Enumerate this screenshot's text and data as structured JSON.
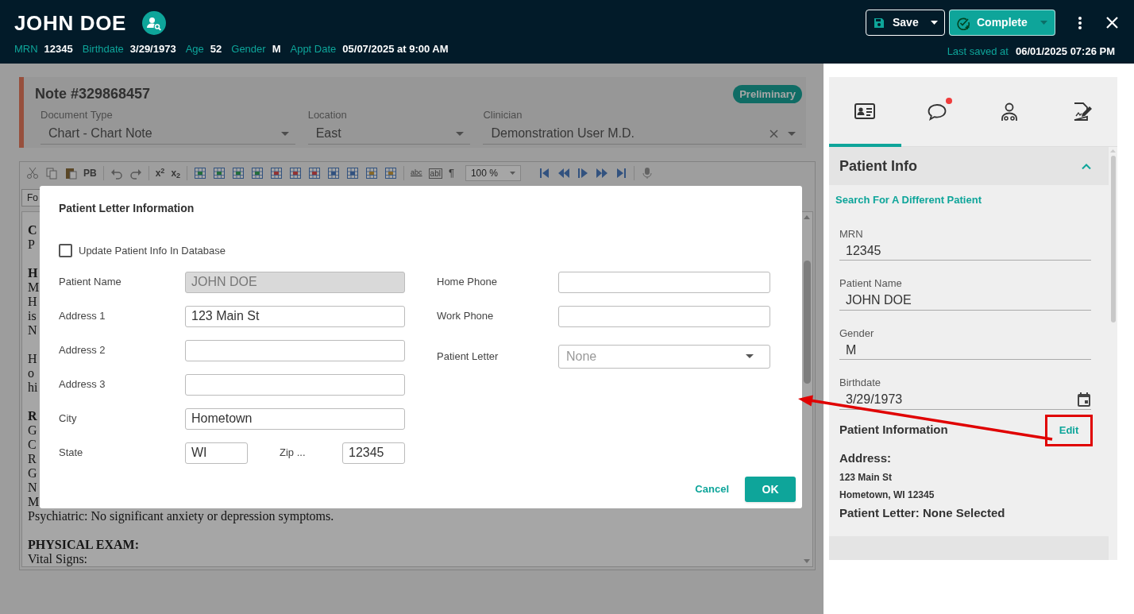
{
  "header": {
    "patient_name": "JOHN DOE",
    "meta": [
      {
        "label": "MRN",
        "value": "12345"
      },
      {
        "label": "Birthdate",
        "value": "3/29/1973"
      },
      {
        "label": "Age",
        "value": "52"
      },
      {
        "label": "Gender",
        "value": "M"
      },
      {
        "label": "Appt Date",
        "value": "05/07/2025 at 9:00 AM"
      }
    ],
    "save_button": "Save",
    "complete_button": "Complete",
    "last_saved_label": "Last saved at",
    "last_saved_value": "06/01/2025 07:26 PM"
  },
  "note": {
    "title": "Note #329868457",
    "status": "Preliminary",
    "fields": [
      {
        "label": "Document Type",
        "value": "Chart - Chart Note",
        "clearable": false
      },
      {
        "label": "Location",
        "value": "East",
        "clearable": false
      },
      {
        "label": "Clinician",
        "value": "Demonstration User M.D.",
        "clearable": true
      }
    ]
  },
  "toolbar": {
    "paste_special": "PB",
    "superscript": "x$^{2}$",
    "subscript": "x$_{2}$",
    "spellcheck": "abc",
    "field": "abl",
    "pilcrow": "¶",
    "zoom": "100 %"
  },
  "font_select": "Fo",
  "editor": {
    "paragraphs": [
      {
        "lines": [
          {
            "text": "C",
            "bold": true
          },
          {
            "text": "P",
            "bold": false
          }
        ]
      },
      {
        "lines": [
          {
            "text": "H",
            "bold": true
          },
          {
            "text": "M",
            "bold": false
          },
          {
            "text": "H",
            "bold": false
          },
          {
            "text": "is",
            "bold": false
          },
          {
            "text": "N",
            "bold": false
          }
        ]
      },
      {
        "lines": [
          {
            "text": "H",
            "bold": false
          },
          {
            "text": "o",
            "bold": false
          },
          {
            "text": "hi",
            "bold": false
          }
        ]
      },
      {
        "lines": [
          {
            "text": "R",
            "bold": true
          },
          {
            "text": "G",
            "bold": false
          },
          {
            "text": "C",
            "bold": false
          },
          {
            "text": "R",
            "bold": false
          },
          {
            "text": "G",
            "bold": false
          },
          {
            "text": "N",
            "bold": false
          },
          {
            "text": "M",
            "bold": false
          },
          {
            "text": "Psychiatric: No significant anxiety or depression symptoms.",
            "bold": false
          }
        ]
      },
      {
        "lines": [
          {
            "text": "PHYSICAL EXAM:",
            "bold": true
          },
          {
            "text": "Vital Signs:",
            "bold": false
          }
        ]
      }
    ]
  },
  "dialog": {
    "title": "Patient Letter Information",
    "update_checkbox": {
      "label": "Update Patient Info In Database",
      "checked": false
    },
    "left_fields": [
      {
        "label": "Patient Name",
        "value": "JOHN DOE",
        "disabled": true
      },
      {
        "label": "Address 1",
        "value": "123 Main St",
        "disabled": false
      },
      {
        "label": "Address 2",
        "disabled": false
      },
      {
        "label": "Address 3",
        "disabled": false
      },
      {
        "label": "City",
        "value": "Hometown",
        "disabled": false
      }
    ],
    "state": {
      "label": "State",
      "value": "WI"
    },
    "zip": {
      "label": "Zip ...",
      "value": "12345"
    },
    "right_fields": [
      {
        "label": "Home Phone",
        "kind": "text"
      },
      {
        "label": "Work Phone",
        "kind": "text"
      },
      {
        "label": "Patient Letter",
        "kind": "select",
        "placeholder": "None"
      }
    ],
    "cancel_button": "Cancel",
    "ok_button": "OK"
  },
  "sidebar": {
    "tabs": [
      {
        "selected": true,
        "notification": false
      },
      {
        "selected": false,
        "notification": true
      },
      {
        "selected": false,
        "notification": false
      },
      {
        "selected": false,
        "notification": false
      }
    ],
    "section": {
      "title": "Patient Info",
      "expanded": true,
      "search_link": "Search For A Different Patient",
      "fields": [
        {
          "label": "MRN",
          "value": "12345",
          "kind": "text"
        },
        {
          "label": "Patient Name",
          "value": "JOHN DOE",
          "kind": "text"
        },
        {
          "label": "Gender",
          "value": "M",
          "kind": "text"
        },
        {
          "label": "Birthdate",
          "value": "3/29/1973",
          "kind": "date"
        }
      ],
      "info_title": "Patient Information",
      "edit_link": "Edit",
      "address_label": "Address:",
      "address_lines": [
        "123 Main St",
        "Hometown, WI 12345"
      ],
      "patient_letter": "Patient Letter: None Selected"
    }
  }
}
